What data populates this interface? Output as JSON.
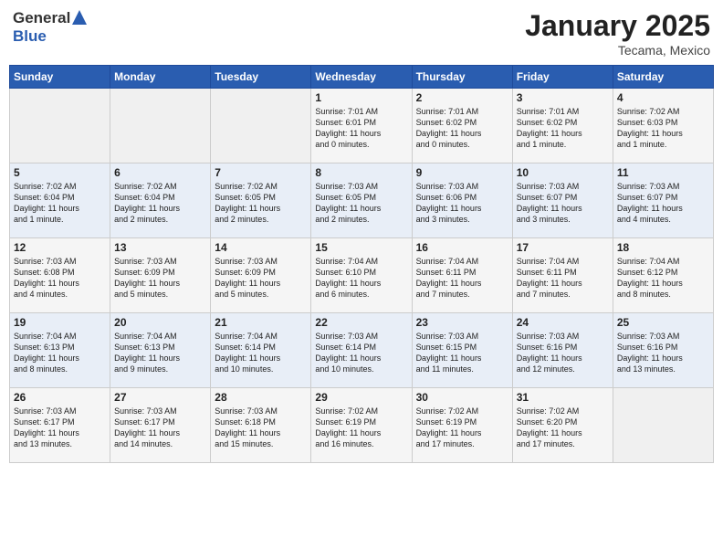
{
  "header": {
    "logo_general": "General",
    "logo_blue": "Blue",
    "month_year": "January 2025",
    "location": "Tecama, Mexico"
  },
  "days_of_week": [
    "Sunday",
    "Monday",
    "Tuesday",
    "Wednesday",
    "Thursday",
    "Friday",
    "Saturday"
  ],
  "weeks": [
    [
      {
        "day": "",
        "content": ""
      },
      {
        "day": "",
        "content": ""
      },
      {
        "day": "",
        "content": ""
      },
      {
        "day": "1",
        "content": "Sunrise: 7:01 AM\nSunset: 6:01 PM\nDaylight: 11 hours\nand 0 minutes."
      },
      {
        "day": "2",
        "content": "Sunrise: 7:01 AM\nSunset: 6:02 PM\nDaylight: 11 hours\nand 0 minutes."
      },
      {
        "day": "3",
        "content": "Sunrise: 7:01 AM\nSunset: 6:02 PM\nDaylight: 11 hours\nand 1 minute."
      },
      {
        "day": "4",
        "content": "Sunrise: 7:02 AM\nSunset: 6:03 PM\nDaylight: 11 hours\nand 1 minute."
      }
    ],
    [
      {
        "day": "5",
        "content": "Sunrise: 7:02 AM\nSunset: 6:04 PM\nDaylight: 11 hours\nand 1 minute."
      },
      {
        "day": "6",
        "content": "Sunrise: 7:02 AM\nSunset: 6:04 PM\nDaylight: 11 hours\nand 2 minutes."
      },
      {
        "day": "7",
        "content": "Sunrise: 7:02 AM\nSunset: 6:05 PM\nDaylight: 11 hours\nand 2 minutes."
      },
      {
        "day": "8",
        "content": "Sunrise: 7:03 AM\nSunset: 6:05 PM\nDaylight: 11 hours\nand 2 minutes."
      },
      {
        "day": "9",
        "content": "Sunrise: 7:03 AM\nSunset: 6:06 PM\nDaylight: 11 hours\nand 3 minutes."
      },
      {
        "day": "10",
        "content": "Sunrise: 7:03 AM\nSunset: 6:07 PM\nDaylight: 11 hours\nand 3 minutes."
      },
      {
        "day": "11",
        "content": "Sunrise: 7:03 AM\nSunset: 6:07 PM\nDaylight: 11 hours\nand 4 minutes."
      }
    ],
    [
      {
        "day": "12",
        "content": "Sunrise: 7:03 AM\nSunset: 6:08 PM\nDaylight: 11 hours\nand 4 minutes."
      },
      {
        "day": "13",
        "content": "Sunrise: 7:03 AM\nSunset: 6:09 PM\nDaylight: 11 hours\nand 5 minutes."
      },
      {
        "day": "14",
        "content": "Sunrise: 7:03 AM\nSunset: 6:09 PM\nDaylight: 11 hours\nand 5 minutes."
      },
      {
        "day": "15",
        "content": "Sunrise: 7:04 AM\nSunset: 6:10 PM\nDaylight: 11 hours\nand 6 minutes."
      },
      {
        "day": "16",
        "content": "Sunrise: 7:04 AM\nSunset: 6:11 PM\nDaylight: 11 hours\nand 7 minutes."
      },
      {
        "day": "17",
        "content": "Sunrise: 7:04 AM\nSunset: 6:11 PM\nDaylight: 11 hours\nand 7 minutes."
      },
      {
        "day": "18",
        "content": "Sunrise: 7:04 AM\nSunset: 6:12 PM\nDaylight: 11 hours\nand 8 minutes."
      }
    ],
    [
      {
        "day": "19",
        "content": "Sunrise: 7:04 AM\nSunset: 6:13 PM\nDaylight: 11 hours\nand 8 minutes."
      },
      {
        "day": "20",
        "content": "Sunrise: 7:04 AM\nSunset: 6:13 PM\nDaylight: 11 hours\nand 9 minutes."
      },
      {
        "day": "21",
        "content": "Sunrise: 7:04 AM\nSunset: 6:14 PM\nDaylight: 11 hours\nand 10 minutes."
      },
      {
        "day": "22",
        "content": "Sunrise: 7:03 AM\nSunset: 6:14 PM\nDaylight: 11 hours\nand 10 minutes."
      },
      {
        "day": "23",
        "content": "Sunrise: 7:03 AM\nSunset: 6:15 PM\nDaylight: 11 hours\nand 11 minutes."
      },
      {
        "day": "24",
        "content": "Sunrise: 7:03 AM\nSunset: 6:16 PM\nDaylight: 11 hours\nand 12 minutes."
      },
      {
        "day": "25",
        "content": "Sunrise: 7:03 AM\nSunset: 6:16 PM\nDaylight: 11 hours\nand 13 minutes."
      }
    ],
    [
      {
        "day": "26",
        "content": "Sunrise: 7:03 AM\nSunset: 6:17 PM\nDaylight: 11 hours\nand 13 minutes."
      },
      {
        "day": "27",
        "content": "Sunrise: 7:03 AM\nSunset: 6:17 PM\nDaylight: 11 hours\nand 14 minutes."
      },
      {
        "day": "28",
        "content": "Sunrise: 7:03 AM\nSunset: 6:18 PM\nDaylight: 11 hours\nand 15 minutes."
      },
      {
        "day": "29",
        "content": "Sunrise: 7:02 AM\nSunset: 6:19 PM\nDaylight: 11 hours\nand 16 minutes."
      },
      {
        "day": "30",
        "content": "Sunrise: 7:02 AM\nSunset: 6:19 PM\nDaylight: 11 hours\nand 17 minutes."
      },
      {
        "day": "31",
        "content": "Sunrise: 7:02 AM\nSunset: 6:20 PM\nDaylight: 11 hours\nand 17 minutes."
      },
      {
        "day": "",
        "content": ""
      }
    ]
  ]
}
